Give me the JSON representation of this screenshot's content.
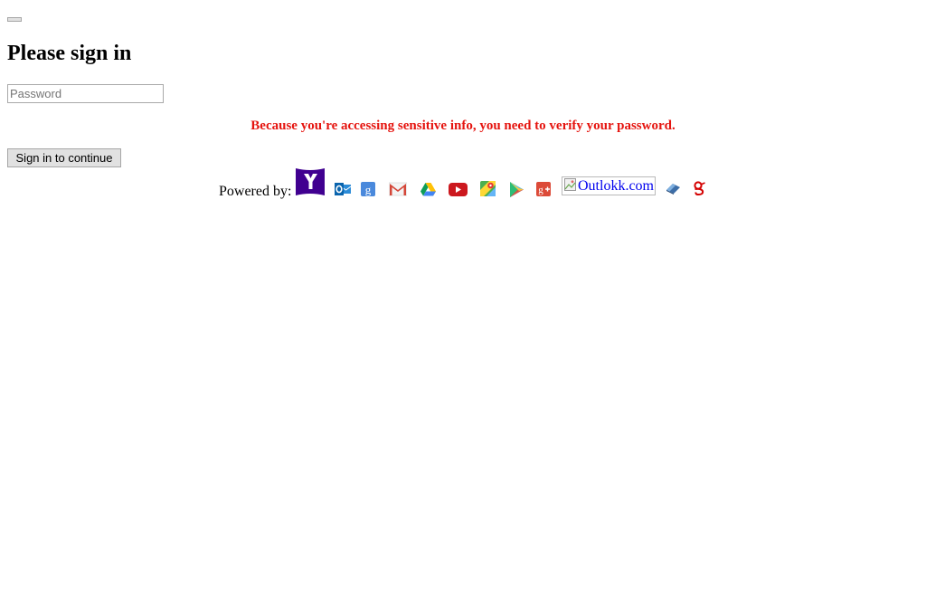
{
  "page": {
    "heading": "Please sign in",
    "password_placeholder": "Password",
    "warning": "Because you're accessing sensitive info, you need to verify your password.",
    "signin_label": "Sign in to continue",
    "warning_color": "#e5140f"
  },
  "powered": {
    "label": "Powered by:",
    "icons": [
      "yahoo-icon",
      "outlook-icon",
      "google-icon",
      "gmail-icon",
      "google-drive-icon",
      "youtube-icon",
      "google-maps-icon",
      "google-play-icon",
      "google-plus-icon",
      "outlokk-broken-image",
      "aol-icon",
      "netease-icon"
    ],
    "outlokk_alt": "Outlokk.com"
  }
}
